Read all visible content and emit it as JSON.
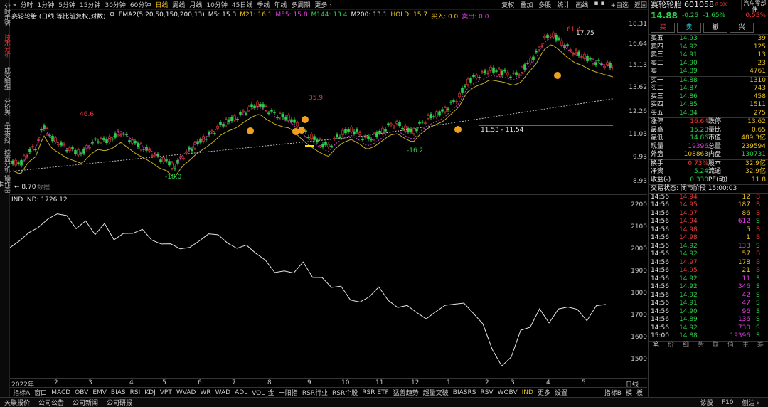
{
  "side_tabs": [
    "分时走势",
    "技术分析",
    "成交明细",
    "分价表",
    "基本资料",
    "控盘分析",
    "操作基本"
  ],
  "top_tabs": [
    "分时",
    "1分钟",
    "5分钟",
    "15分钟",
    "30分钟",
    "60分钟",
    "日线",
    "周线",
    "月线",
    "10分钟",
    "45日线",
    "季线",
    "年线",
    "多周期",
    "更多 ›"
  ],
  "top_right": [
    "复权",
    "叠加",
    "多股",
    "统计",
    "画线",
    "▪ ▪",
    "+自选",
    "返回"
  ],
  "indicator_line": {
    "name": "赛轮轮胎 (日线,等比前复权,对数)",
    "ema": "EMA2(5,20,50,150,200,13)",
    "m5": "M5: 15.3",
    "m21": "M21: 16.1",
    "m55": "M55: 15.8",
    "m144": "M144: 13.4",
    "m200": "M200: 13.1",
    "hold": "HOLD: 15.7",
    "buy": "买入: 0.0",
    "sell": "卖出: 0.0"
  },
  "price_axis": [
    "18.31",
    "16.64",
    "15.13",
    "13.62",
    "12.26",
    "11.03",
    "9.93",
    "8.93"
  ],
  "annotations": {
    "a1": "46.6",
    "a2": "-18.0",
    "a3": "35.9",
    "a4": "-16.2",
    "a5": "61.4",
    "a6": "17.75",
    "a7": "11.53 - 11.54",
    "a8": "← 8.70",
    "a9": "数据"
  },
  "ind2": {
    "name": "IND",
    "value": "IND: 1726.12"
  },
  "ind_axis": [
    "2200",
    "2100",
    "2000",
    "1900",
    "1800",
    "1700",
    "1600",
    "1500"
  ],
  "x_labels": [
    "2022年",
    "2",
    "3",
    "4",
    "5",
    "6",
    "7",
    "8",
    "9",
    "10",
    "11",
    "12",
    "1",
    "2",
    "3",
    "4",
    "5"
  ],
  "x_right": "日线",
  "bottom_tabs": [
    "指标A",
    "窗口",
    "MACD",
    "OBV",
    "EMV",
    "BIAS",
    "RSI",
    "KDJ",
    "VPT",
    "WVAD",
    "WR",
    "WAD",
    "ADL",
    "VOL_金",
    "一阳指",
    "RSR行业",
    "RSR个股",
    "RSR ETF",
    "猛善趋势",
    "超量突破",
    "BIASRS",
    "RSV",
    "WOBV",
    "IND",
    "更多",
    "设置"
  ],
  "bottom_right": [
    "指标B",
    "模",
    "板"
  ],
  "footer": [
    "关联报价",
    "公司公告",
    "公司新闻",
    "公司研报"
  ],
  "footer_right": [
    "诊股",
    "F10",
    "侧边 ›"
  ],
  "stock": {
    "name": "赛轮轮胎",
    "code": "601058",
    "tag": "R 500",
    "sector": "汽车零部件",
    "price": "14.88",
    "change": "-0.25",
    "pct": "-1.65%",
    "sector_pct": "0.55%"
  },
  "actions": [
    "买",
    "卖",
    "撤",
    "兴"
  ],
  "asks": [
    {
      "l": "卖五",
      "p": "14.93",
      "v": "39"
    },
    {
      "l": "卖四",
      "p": "14.92",
      "v": "125"
    },
    {
      "l": "卖三",
      "p": "14.91",
      "v": "13"
    },
    {
      "l": "卖二",
      "p": "14.90",
      "v": "23"
    },
    {
      "l": "卖一",
      "p": "14.89",
      "v": "4761"
    }
  ],
  "bids": [
    {
      "l": "买一",
      "p": "14.88",
      "v": "1310"
    },
    {
      "l": "买二",
      "p": "14.87",
      "v": "743"
    },
    {
      "l": "买三",
      "p": "14.86",
      "v": "458"
    },
    {
      "l": "买四",
      "p": "14.85",
      "v": "1511"
    },
    {
      "l": "买五",
      "p": "14.84",
      "v": "275"
    }
  ],
  "stats": [
    [
      "涨停",
      "16.64",
      "跌停",
      "13.62"
    ],
    [
      "最高",
      "15.28",
      "量比",
      "0.65"
    ],
    [
      "最低",
      "14.86",
      "市值",
      "489.3亿"
    ],
    [
      "现量",
      "19396",
      "总量",
      "239594"
    ],
    [
      "外盘",
      "108863",
      "内盘",
      "130731"
    ]
  ],
  "stats2": [
    [
      "换手",
      "0.73%",
      "股本",
      "32.9亿"
    ],
    [
      "净资",
      "5.24",
      "流通",
      "32.9亿"
    ],
    [
      "收益(-)",
      "0.330",
      "PE(动)",
      "11.8"
    ]
  ],
  "trade_status": "交易状态: 闭市阶段 15:00:03",
  "ticks": [
    [
      "14:56",
      "14.94",
      "12",
      "B"
    ],
    [
      "14:56",
      "14.95",
      "187",
      "B"
    ],
    [
      "14:56",
      "14.97",
      "86",
      "B"
    ],
    [
      "14:56",
      "14.94",
      "612",
      "S"
    ],
    [
      "14:56",
      "14.98",
      "5",
      "B"
    ],
    [
      "14:56",
      "14.98",
      "1",
      "B"
    ],
    [
      "14:56",
      "14.92",
      "133",
      "S"
    ],
    [
      "14:56",
      "14.92",
      "57",
      "B"
    ],
    [
      "14:56",
      "14.97",
      "178",
      "B"
    ],
    [
      "14:56",
      "14.95",
      "21",
      "B"
    ],
    [
      "14:56",
      "14.92",
      "11",
      "S"
    ],
    [
      "14:56",
      "14.92",
      "346",
      "S"
    ],
    [
      "14:56",
      "14.92",
      "42",
      "S"
    ],
    [
      "14:56",
      "14.91",
      "47",
      "S"
    ],
    [
      "14:56",
      "14.90",
      "96",
      "S"
    ],
    [
      "14:56",
      "14.89",
      "136",
      "S"
    ],
    [
      "14:56",
      "14.92",
      "730",
      "S"
    ],
    [
      "15:00",
      "14.88",
      "19396",
      "S"
    ]
  ],
  "rp_tabs": [
    "笔",
    "价",
    "细",
    "势",
    "联",
    "值",
    "主",
    "筹"
  ]
}
